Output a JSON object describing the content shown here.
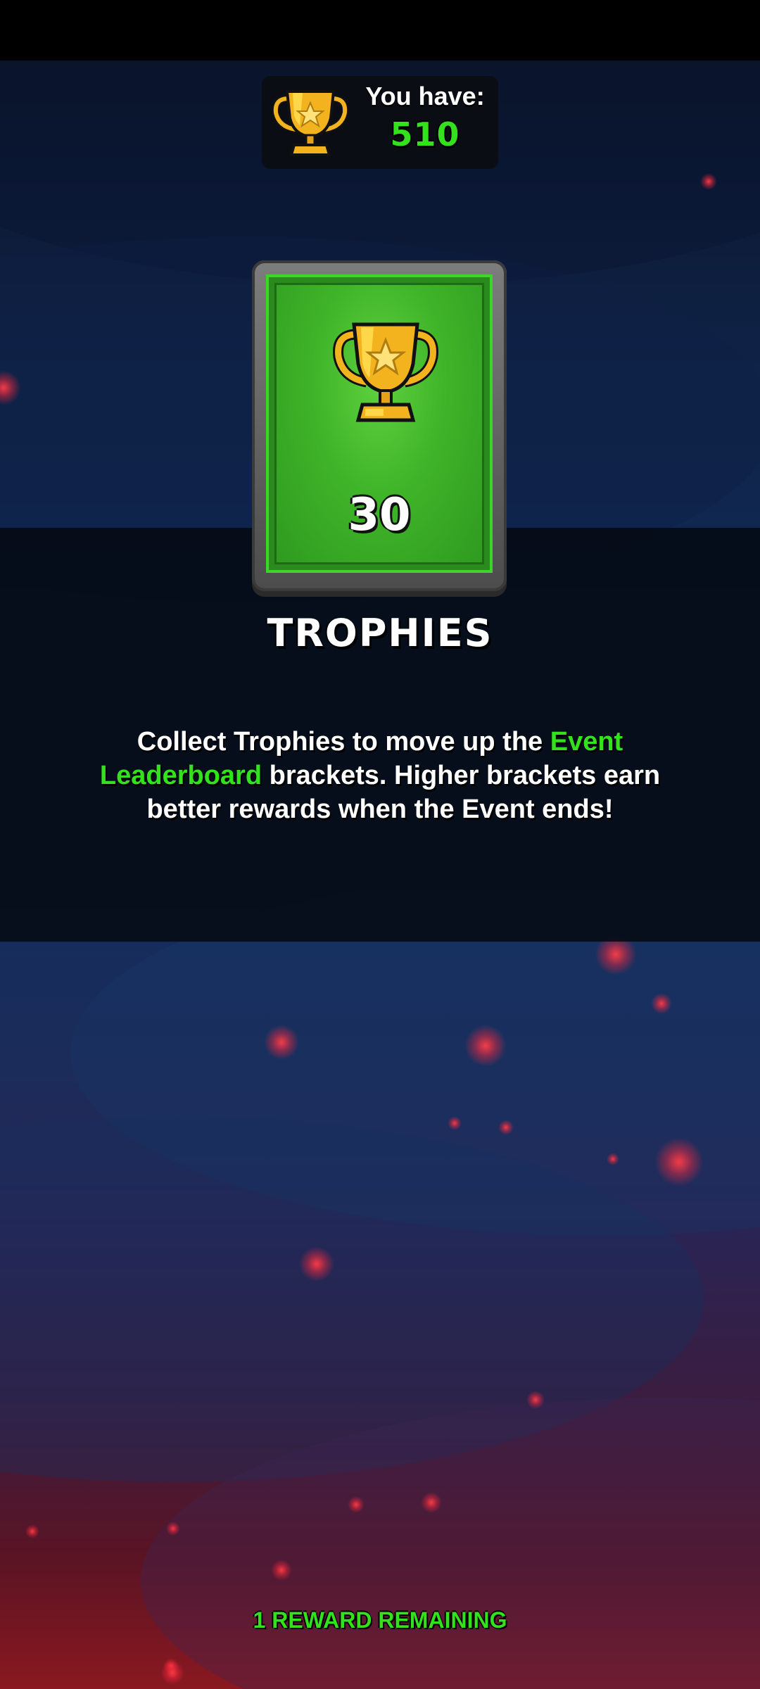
{
  "balance": {
    "label": "You have:",
    "value": "510"
  },
  "reward_card": {
    "amount": "30",
    "icon": "trophy-icon"
  },
  "reward": {
    "title": "TROPHIES",
    "description_parts": [
      "Collect Trophies to move up the ",
      "Event Leaderboard",
      " brackets. Higher brackets earn better rewards when the Event ends!"
    ]
  },
  "footer": {
    "remaining_text": "1 REWARD REMAINING"
  },
  "colors": {
    "accent_green": "#33e21c",
    "card_green": "#3fb429",
    "gold": "#f2b31f"
  }
}
